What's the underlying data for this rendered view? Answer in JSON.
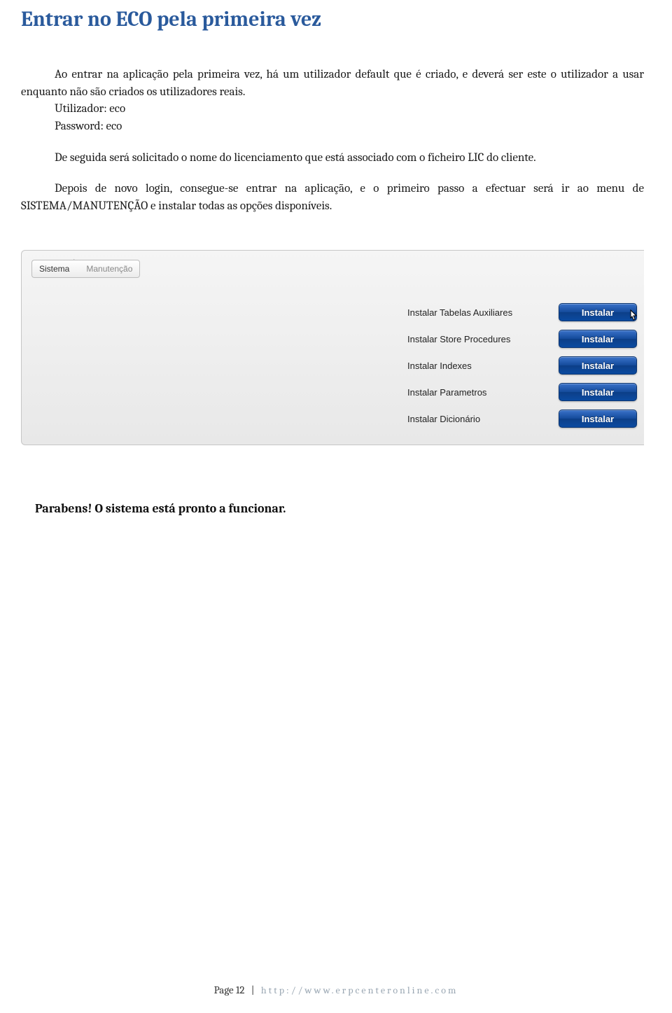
{
  "heading": "Entrar no ECO pela primeira vez",
  "para1": "Ao entrar na aplicação pela primeira vez, há um utilizador default que é criado, e deverá ser este o utilizador a usar enquanto não são criados os utilizadores reais.",
  "user_line": "Utilizador: eco",
  "pass_line": "Password: eco",
  "para2": "De seguida será solicitado o nome do licenciamento que está associado com o ficheiro LIC do cliente.",
  "para3": "Depois de novo login, consegue-se entrar na aplicação, e o primeiro passo a efectuar será ir ao menu de SISTEMA/MANUTENÇÃO e instalar todas as opções disponíveis.",
  "breadcrumb": {
    "first": "Sistema",
    "second": "Manutenção"
  },
  "install_rows": [
    {
      "label": "Instalar Tabelas Auxiliares",
      "button": "Instalar",
      "has_cursor": true
    },
    {
      "label": "Instalar Store Procedures",
      "button": "Instalar",
      "has_cursor": false
    },
    {
      "label": "Instalar Indexes",
      "button": "Instalar",
      "has_cursor": false
    },
    {
      "label": "Instalar Parametros",
      "button": "Instalar",
      "has_cursor": false
    },
    {
      "label": "Instalar Dicionário",
      "button": "Instalar",
      "has_cursor": false
    }
  ],
  "closing": "Parabens! O sistema está pronto a funcionar.",
  "footer": {
    "page": "Page 12",
    "url": "http://www.erpcenteronline.com"
  }
}
